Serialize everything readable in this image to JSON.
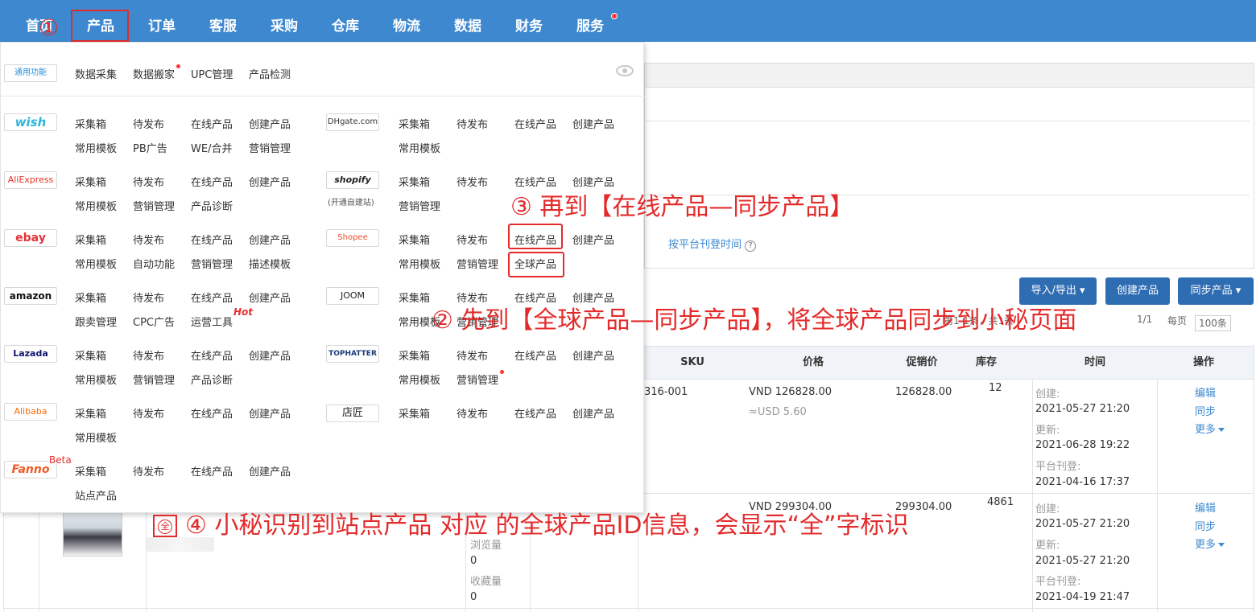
{
  "nav": {
    "items": [
      "首页",
      "产品",
      "订单",
      "客服",
      "采购",
      "仓库",
      "物流",
      "数据",
      "财务",
      "服务"
    ]
  },
  "annotations": {
    "step1": "①",
    "step2": "② 先到【全球产品—同步产品】，将全球产品同步到小秘页面",
    "step3": "③ 再到【在线产品—同步产品】",
    "step4": "④ 小秘识别到站点产品 对应 的全球产品ID信息，会显示“全”字标识",
    "badge": "全"
  },
  "dropdown": {
    "common": {
      "logo": "通用功能",
      "links": [
        "数据采集",
        "数据搬家",
        "UPC管理",
        "产品检测"
      ]
    },
    "left_platforms": [
      {
        "logo": "wish",
        "row1": [
          "采集箱",
          "待发布",
          "在线产品",
          "创建产品"
        ],
        "row2": [
          "常用模板",
          "PB广告",
          "WE/合并",
          "营销管理"
        ]
      },
      {
        "logo": "AliExpress",
        "row1": [
          "采集箱",
          "待发布",
          "在线产品",
          "创建产品"
        ],
        "row2": [
          "常用模板",
          "营销管理",
          "产品诊断"
        ]
      },
      {
        "logo": "ebay",
        "row1": [
          "采集箱",
          "待发布",
          "在线产品",
          "创建产品"
        ],
        "row2": [
          "常用模板",
          "自动功能",
          "营销管理",
          "描述模板"
        ]
      },
      {
        "logo": "amazon",
        "row1": [
          "采集箱",
          "待发布",
          "在线产品",
          "创建产品"
        ],
        "row2": [
          "跟卖管理",
          "CPC广告",
          "运营工具"
        ]
      },
      {
        "logo": "Lazada",
        "row1": [
          "采集箱",
          "待发布",
          "在线产品",
          "创建产品"
        ],
        "row2": [
          "常用模板",
          "营销管理",
          "产品诊断"
        ]
      },
      {
        "logo": "Alibaba",
        "row1": [
          "采集箱",
          "待发布",
          "在线产品",
          "创建产品"
        ],
        "row2": [
          "常用模板"
        ]
      },
      {
        "logo": "Fanno",
        "row1": [
          "采集箱",
          "待发布",
          "在线产品",
          "创建产品"
        ],
        "row2": [
          "站点产品"
        ]
      }
    ],
    "right_platforms": [
      {
        "logo": "DHgate.com",
        "row1": [
          "采集箱",
          "待发布",
          "在线产品",
          "创建产品"
        ],
        "row2": [
          "常用模板"
        ]
      },
      {
        "logo": "shopify",
        "sub": "(开通自建站)",
        "row1": [
          "采集箱",
          "待发布",
          "在线产品",
          "创建产品"
        ],
        "row2": [
          "营销管理"
        ]
      },
      {
        "logo": "Shopee",
        "row1": [
          "采集箱",
          "待发布",
          "在线产品",
          "创建产品"
        ],
        "row2": [
          "常用模板",
          "营销管理",
          "全球产品"
        ]
      },
      {
        "logo": "JOOM",
        "row1": [
          "采集箱",
          "待发布",
          "在线产品",
          "创建产品"
        ],
        "row2": [
          "常用模板",
          "营销管理"
        ]
      },
      {
        "logo": "TOPHATTER",
        "row1": [
          "采集箱",
          "待发布",
          "在线产品",
          "创建产品"
        ],
        "row2": [
          "常用模板",
          "营销管理"
        ]
      },
      {
        "logo": "店匠",
        "row1": [
          "采集箱",
          "待发布",
          "在线产品",
          "创建产品"
        ],
        "row2": []
      }
    ],
    "hot_label": "Hot",
    "beta_label": "Beta"
  },
  "background": {
    "filter_link": "按平台刊登时间",
    "help": "?",
    "buttons": {
      "import_export": "导入/导出",
      "create": "创建产品",
      "sync": "同步产品"
    },
    "pager": {
      "left": "第1-1条，共1条",
      "page": "1/1",
      "per_page": "每页",
      "per_page_value": "100条"
    },
    "table": {
      "headers": [
        "SKU",
        "价格",
        "促销价",
        "库存",
        "时间",
        "操作"
      ],
      "rows": [
        {
          "sku": "316-001",
          "price": "VND  126828.00",
          "price_usd": "≈USD 5.60",
          "promo": "126828.00",
          "stock": "12",
          "time": [
            "创建:",
            "2021-05-27 21:20",
            "更新:",
            "2021-06-28 19:22",
            "平台刊登:",
            "2021-04-16 17:37"
          ],
          "ops": [
            "编辑",
            "同步",
            "更多"
          ]
        },
        {
          "sku": "",
          "price": "VND  299304.00",
          "price_usd": "",
          "promo": "299304.00",
          "stock": "4861",
          "views_label": "浏览量",
          "views": "0",
          "fav_label": "收藏量",
          "fav": "0",
          "time": [
            "创建:",
            "2021-05-27 21:20",
            "更新:",
            "2021-05-27 21:20",
            "平台刊登:",
            "2021-04-19 21:47"
          ],
          "ops": [
            "编辑",
            "同步",
            "更多"
          ]
        }
      ]
    }
  }
}
